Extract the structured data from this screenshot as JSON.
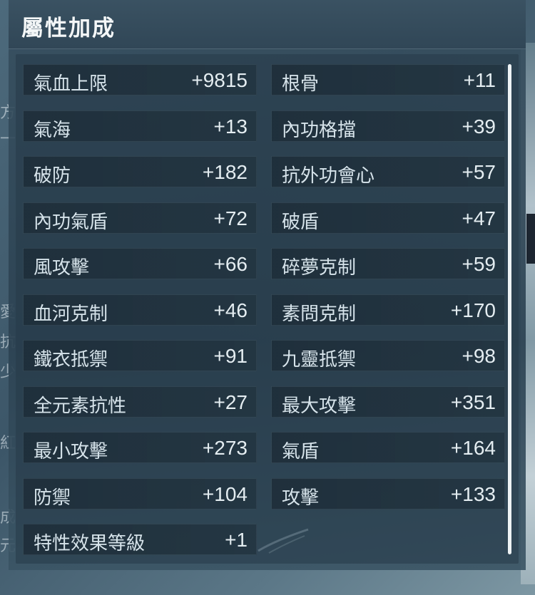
{
  "panel": {
    "title": "屬性加成"
  },
  "stats": {
    "left": [
      {
        "label": "氣血上限",
        "value": "+9815"
      },
      {
        "label": "氣海",
        "value": "+13"
      },
      {
        "label": "破防",
        "value": "+182"
      },
      {
        "label": "內功氣盾",
        "value": "+72"
      },
      {
        "label": "風攻擊",
        "value": "+66"
      },
      {
        "label": "血河克制",
        "value": "+46"
      },
      {
        "label": "鐵衣抵禦",
        "value": "+91"
      },
      {
        "label": "全元素抗性",
        "value": "+27"
      },
      {
        "label": "最小攻擊",
        "value": "+273"
      },
      {
        "label": "防禦",
        "value": "+104"
      },
      {
        "label": "特性效果等級",
        "value": "+1"
      }
    ],
    "right": [
      {
        "label": "根骨",
        "value": "+11"
      },
      {
        "label": "內功格擋",
        "value": "+39"
      },
      {
        "label": "抗外功會心",
        "value": "+57"
      },
      {
        "label": "破盾",
        "value": "+47"
      },
      {
        "label": "碎夢克制",
        "value": "+59"
      },
      {
        "label": "素問克制",
        "value": "+170"
      },
      {
        "label": "九靈抵禦",
        "value": "+98"
      },
      {
        "label": "最大攻擊",
        "value": "+351"
      },
      {
        "label": "氣盾",
        "value": "+164"
      },
      {
        "label": "攻擊",
        "value": "+133"
      }
    ]
  },
  "background": {
    "fragments": [
      "方",
      "一",
      "愛",
      "抗",
      "少",
      "紅",
      "成",
      "元"
    ]
  },
  "colors": {
    "panel_bg": "#2c4252",
    "stat_bg": "#1e2e3a",
    "text": "#d6e3ea",
    "scrollbar": "#eef3f5"
  }
}
